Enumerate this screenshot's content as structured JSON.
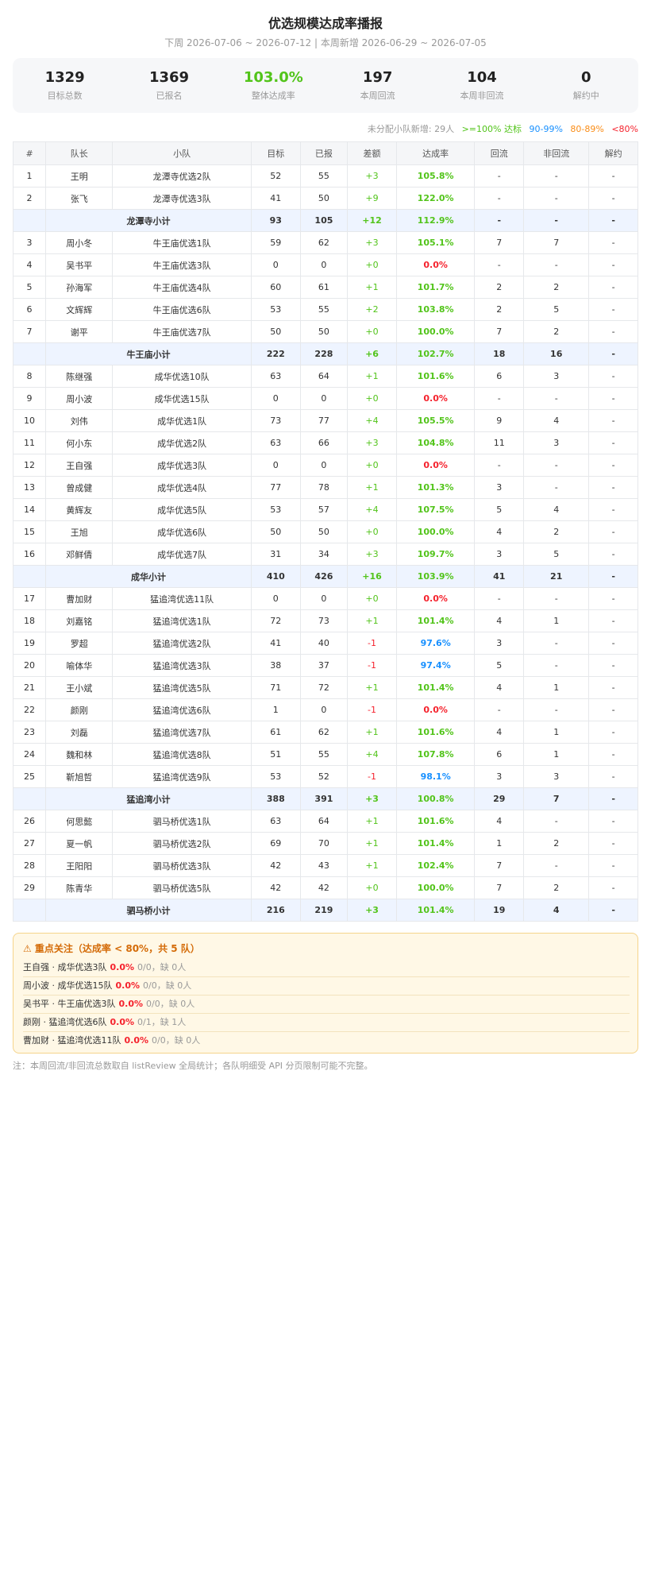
{
  "title": "优选规模达成率播报",
  "subtitle": "下周 2026-07-06 ~ 2026-07-12 | 本周新增 2026-06-29 ~ 2026-07-05",
  "stats": [
    {
      "value": "1329",
      "label": "目标总数",
      "highlight": false
    },
    {
      "value": "1369",
      "label": "已报名",
      "highlight": false
    },
    {
      "value": "103.0%",
      "label": "整体达成率",
      "highlight": true
    },
    {
      "value": "197",
      "label": "本周回流",
      "highlight": false
    },
    {
      "value": "104",
      "label": "本周非回流",
      "highlight": false
    },
    {
      "value": "0",
      "label": "解约中",
      "highlight": false
    }
  ],
  "legend": {
    "unassigned": "未分配小队新增: 29人",
    "green": ">=100% 达标",
    "blue": "90-99%",
    "orange": "80-89%",
    "red": "<80%"
  },
  "table": {
    "headers": [
      "#",
      "队长",
      "小队",
      "目标",
      "已报",
      "差额",
      "达成率",
      "回流",
      "非回流",
      "解约"
    ],
    "rows": [
      {
        "type": "row",
        "cells": [
          "1",
          "王明",
          "龙潭寺优选2队",
          "52",
          "55",
          "+3",
          "105.8%",
          "-",
          "-",
          "-"
        ],
        "d": "pos",
        "r": "green"
      },
      {
        "type": "row",
        "cells": [
          "2",
          "张飞",
          "龙潭寺优选3队",
          "41",
          "50",
          "+9",
          "122.0%",
          "-",
          "-",
          "-"
        ],
        "d": "pos",
        "r": "green"
      },
      {
        "type": "sub",
        "cells": [
          "",
          "龙潭寺小计",
          "93",
          "105",
          "+12",
          "112.9%",
          "-",
          "-",
          "-"
        ],
        "d": "pos",
        "r": "green"
      },
      {
        "type": "row",
        "cells": [
          "3",
          "周小冬",
          "牛王庙优选1队",
          "59",
          "62",
          "+3",
          "105.1%",
          "7",
          "7",
          "-"
        ],
        "d": "pos",
        "r": "green"
      },
      {
        "type": "row",
        "cells": [
          "4",
          "吴书平",
          "牛王庙优选3队",
          "0",
          "0",
          "+0",
          "0.0%",
          "-",
          "-",
          "-"
        ],
        "d": "zero",
        "r": "red"
      },
      {
        "type": "row",
        "cells": [
          "5",
          "孙海军",
          "牛王庙优选4队",
          "60",
          "61",
          "+1",
          "101.7%",
          "2",
          "2",
          "-"
        ],
        "d": "pos",
        "r": "green"
      },
      {
        "type": "row",
        "cells": [
          "6",
          "文辉辉",
          "牛王庙优选6队",
          "53",
          "55",
          "+2",
          "103.8%",
          "2",
          "5",
          "-"
        ],
        "d": "pos",
        "r": "green"
      },
      {
        "type": "row",
        "cells": [
          "7",
          "谢平",
          "牛王庙优选7队",
          "50",
          "50",
          "+0",
          "100.0%",
          "7",
          "2",
          "-"
        ],
        "d": "zero",
        "r": "green"
      },
      {
        "type": "sub",
        "cells": [
          "",
          "牛王庙小计",
          "222",
          "228",
          "+6",
          "102.7%",
          "18",
          "16",
          "-"
        ],
        "d": "pos",
        "r": "green"
      },
      {
        "type": "row",
        "cells": [
          "8",
          "陈继强",
          "成华优选10队",
          "63",
          "64",
          "+1",
          "101.6%",
          "6",
          "3",
          "-"
        ],
        "d": "pos",
        "r": "green"
      },
      {
        "type": "row",
        "cells": [
          "9",
          "周小波",
          "成华优选15队",
          "0",
          "0",
          "+0",
          "0.0%",
          "-",
          "-",
          "-"
        ],
        "d": "zero",
        "r": "red"
      },
      {
        "type": "row",
        "cells": [
          "10",
          "刘伟",
          "成华优选1队",
          "73",
          "77",
          "+4",
          "105.5%",
          "9",
          "4",
          "-"
        ],
        "d": "pos",
        "r": "green"
      },
      {
        "type": "row",
        "cells": [
          "11",
          "何小东",
          "成华优选2队",
          "63",
          "66",
          "+3",
          "104.8%",
          "11",
          "3",
          "-"
        ],
        "d": "pos",
        "r": "green"
      },
      {
        "type": "row",
        "cells": [
          "12",
          "王自强",
          "成华优选3队",
          "0",
          "0",
          "+0",
          "0.0%",
          "-",
          "-",
          "-"
        ],
        "d": "zero",
        "r": "red"
      },
      {
        "type": "row",
        "cells": [
          "13",
          "曾成健",
          "成华优选4队",
          "77",
          "78",
          "+1",
          "101.3%",
          "3",
          "-",
          "-"
        ],
        "d": "pos",
        "r": "green"
      },
      {
        "type": "row",
        "cells": [
          "14",
          "黄辉友",
          "成华优选5队",
          "53",
          "57",
          "+4",
          "107.5%",
          "5",
          "4",
          "-"
        ],
        "d": "pos",
        "r": "green"
      },
      {
        "type": "row",
        "cells": [
          "15",
          "王旭",
          "成华优选6队",
          "50",
          "50",
          "+0",
          "100.0%",
          "4",
          "2",
          "-"
        ],
        "d": "zero",
        "r": "green"
      },
      {
        "type": "row",
        "cells": [
          "16",
          "邓鲜倩",
          "成华优选7队",
          "31",
          "34",
          "+3",
          "109.7%",
          "3",
          "5",
          "-"
        ],
        "d": "pos",
        "r": "green"
      },
      {
        "type": "sub",
        "cells": [
          "",
          "成华小计",
          "410",
          "426",
          "+16",
          "103.9%",
          "41",
          "21",
          "-"
        ],
        "d": "pos",
        "r": "green"
      },
      {
        "type": "row",
        "cells": [
          "17",
          "曹加财",
          "猛追湾优选11队",
          "0",
          "0",
          "+0",
          "0.0%",
          "-",
          "-",
          "-"
        ],
        "d": "zero",
        "r": "red"
      },
      {
        "type": "row",
        "cells": [
          "18",
          "刘嘉铭",
          "猛追湾优选1队",
          "72",
          "73",
          "+1",
          "101.4%",
          "4",
          "1",
          "-"
        ],
        "d": "pos",
        "r": "green"
      },
      {
        "type": "row",
        "cells": [
          "19",
          "罗超",
          "猛追湾优选2队",
          "41",
          "40",
          "-1",
          "97.6%",
          "3",
          "-",
          "-"
        ],
        "d": "neg",
        "r": "blue"
      },
      {
        "type": "row",
        "cells": [
          "20",
          "喻体华",
          "猛追湾优选3队",
          "38",
          "37",
          "-1",
          "97.4%",
          "5",
          "-",
          "-"
        ],
        "d": "neg",
        "r": "blue"
      },
      {
        "type": "row",
        "cells": [
          "21",
          "王小斌",
          "猛追湾优选5队",
          "71",
          "72",
          "+1",
          "101.4%",
          "4",
          "1",
          "-"
        ],
        "d": "pos",
        "r": "green"
      },
      {
        "type": "row",
        "cells": [
          "22",
          "颜刚",
          "猛追湾优选6队",
          "1",
          "0",
          "-1",
          "0.0%",
          "-",
          "-",
          "-"
        ],
        "d": "neg",
        "r": "red"
      },
      {
        "type": "row",
        "cells": [
          "23",
          "刘磊",
          "猛追湾优选7队",
          "61",
          "62",
          "+1",
          "101.6%",
          "4",
          "1",
          "-"
        ],
        "d": "pos",
        "r": "green"
      },
      {
        "type": "row",
        "cells": [
          "24",
          "魏和林",
          "猛追湾优选8队",
          "51",
          "55",
          "+4",
          "107.8%",
          "6",
          "1",
          "-"
        ],
        "d": "pos",
        "r": "green"
      },
      {
        "type": "row",
        "cells": [
          "25",
          "靳旭哲",
          "猛追湾优选9队",
          "53",
          "52",
          "-1",
          "98.1%",
          "3",
          "3",
          "-"
        ],
        "d": "neg",
        "r": "blue"
      },
      {
        "type": "sub",
        "cells": [
          "",
          "猛追湾小计",
          "388",
          "391",
          "+3",
          "100.8%",
          "29",
          "7",
          "-"
        ],
        "d": "pos",
        "r": "green"
      },
      {
        "type": "row",
        "cells": [
          "26",
          "何思懿",
          "驷马桥优选1队",
          "63",
          "64",
          "+1",
          "101.6%",
          "4",
          "-",
          "-"
        ],
        "d": "pos",
        "r": "green"
      },
      {
        "type": "row",
        "cells": [
          "27",
          "夏一帆",
          "驷马桥优选2队",
          "69",
          "70",
          "+1",
          "101.4%",
          "1",
          "2",
          "-"
        ],
        "d": "pos",
        "r": "green"
      },
      {
        "type": "row",
        "cells": [
          "28",
          "王阳阳",
          "驷马桥优选3队",
          "42",
          "43",
          "+1",
          "102.4%",
          "7",
          "-",
          "-"
        ],
        "d": "pos",
        "r": "green"
      },
      {
        "type": "row",
        "cells": [
          "29",
          "陈青华",
          "驷马桥优选5队",
          "42",
          "42",
          "+0",
          "100.0%",
          "7",
          "2",
          "-"
        ],
        "d": "zero",
        "r": "green"
      },
      {
        "type": "sub",
        "cells": [
          "",
          "驷马桥小计",
          "216",
          "219",
          "+3",
          "101.4%",
          "19",
          "4",
          "-"
        ],
        "d": "pos",
        "r": "green"
      }
    ]
  },
  "alert": {
    "icon": "warning-icon",
    "title": "⚠ 重点关注（达成率 < 80%，共 5 队）",
    "items": [
      {
        "name": "王自强 · 成华优选3队",
        "rate": "0.0%",
        "detail": "0/0，缺 0人"
      },
      {
        "name": "周小波 · 成华优选15队",
        "rate": "0.0%",
        "detail": "0/0，缺 0人"
      },
      {
        "name": "吴书平 · 牛王庙优选3队",
        "rate": "0.0%",
        "detail": "0/0，缺 0人"
      },
      {
        "name": "颜刚 · 猛追湾优选6队",
        "rate": "0.0%",
        "detail": "0/1，缺 1人"
      },
      {
        "name": "曹加财 · 猛追湾优选11队",
        "rate": "0.0%",
        "detail": "0/0，缺 0人"
      }
    ]
  },
  "note": "注：本周回流/非回流总数取自 listReview 全局统计；各队明细受 API 分页限制可能不完整。",
  "colors": {
    "green": "#52c41a",
    "blue": "#1890ff",
    "orange": "#fa8c16",
    "red": "#f5222d",
    "subtotal_bg": "#eef4ff"
  }
}
